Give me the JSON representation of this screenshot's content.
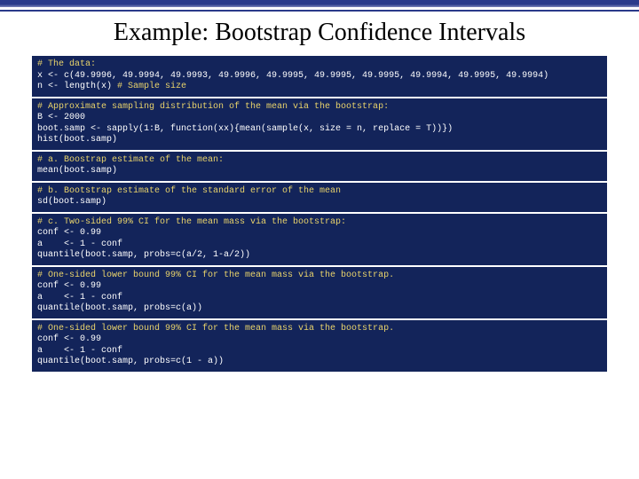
{
  "title": "Example: Bootstrap Confidence Intervals",
  "blocks": {
    "b1": {
      "c1": "# The data:",
      "l1": "x <- c(49.9996, 49.9994, 49.9993, 49.9996, 49.9995, 49.9995, 49.9995, 49.9994, 49.9995, 49.9994)",
      "l2a": "n <- length(x) ",
      "c2": "# Sample size"
    },
    "b2": {
      "c1": "# Approximate sampling distribution of the mean via the bootstrap:",
      "l1": "B <- 2000",
      "l2": "boot.samp <- sapply(1:B, function(xx){mean(sample(x, size = n, replace = T))})",
      "l3": "hist(boot.samp)"
    },
    "b3": {
      "c1": "# a. Boostrap estimate of the mean:",
      "l1": "mean(boot.samp)"
    },
    "b4": {
      "c1": "# b. Bootstrap estimate of the standard error of the mean",
      "l1": "sd(boot.samp)"
    },
    "b5": {
      "c1": "# c. Two-sided 99% CI for the mean mass via the bootstrap:",
      "l1": "conf <- 0.99",
      "l2": "a    <- 1 - conf",
      "l3": "quantile(boot.samp, probs=c(a/2, 1-a/2))"
    },
    "b6": {
      "c1": "# One-sided lower bound 99% CI for the mean mass via the bootstrap.",
      "l1": "conf <- 0.99",
      "l2": "a    <- 1 - conf",
      "l3": "quantile(boot.samp, probs=c(a))"
    },
    "b7": {
      "c1": "# One-sided lower bound 99% CI for the mean mass via the bootstrap.",
      "l1": "conf <- 0.99",
      "l2": "a    <- 1 - conf",
      "l3": "quantile(boot.samp, probs=c(1 - a))"
    }
  }
}
